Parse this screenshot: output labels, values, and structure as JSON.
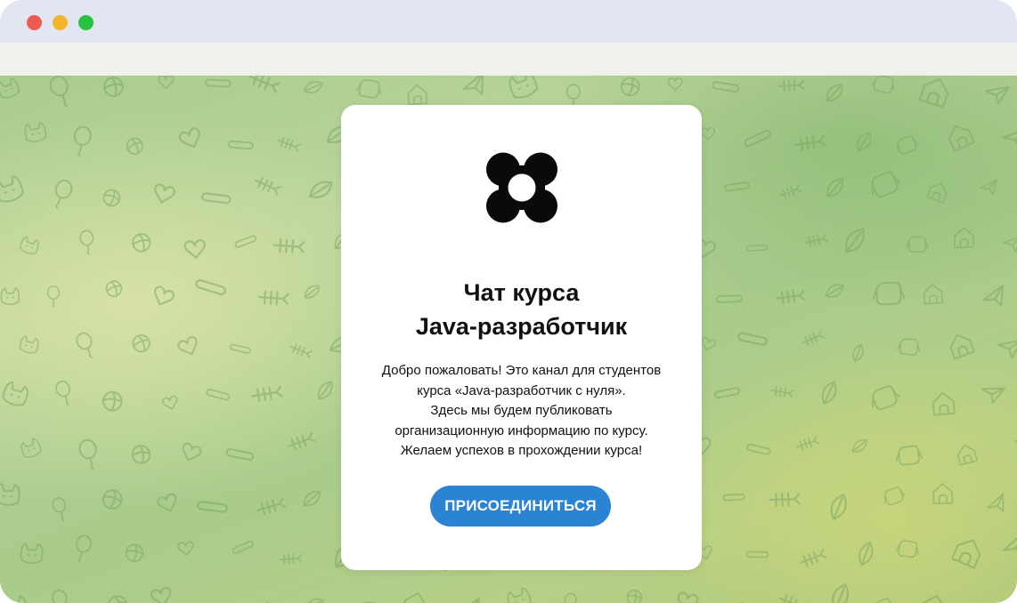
{
  "window": {
    "traffic_lights": {
      "close_color": "#ee5a52",
      "minimize_color": "#f4b52c",
      "zoom_color": "#27c23f"
    }
  },
  "background": {
    "pattern_icons": [
      "cat-icon",
      "dog-icon",
      "bone-icon",
      "balloon-icon",
      "doghouse-icon",
      "fish-bone-icon",
      "ball-icon",
      "paper-plane-icon",
      "leaf-icon",
      "heart-icon"
    ]
  },
  "card": {
    "logo": "four-petal-clover-icon",
    "title_line1": "Чат курса",
    "title_line2": "Java-разработчик",
    "description": [
      "Добро пожаловать! Это канал для студентов",
      "курса «Java-разработчик с нуля».",
      "Здесь мы будем публиковать",
      "организационную информацию по курсу.",
      "Желаем успехов в прохождении курса!"
    ],
    "join_label": "ПРИСОЕДИНИТЬСЯ",
    "accent_color": "#2a83d3"
  }
}
